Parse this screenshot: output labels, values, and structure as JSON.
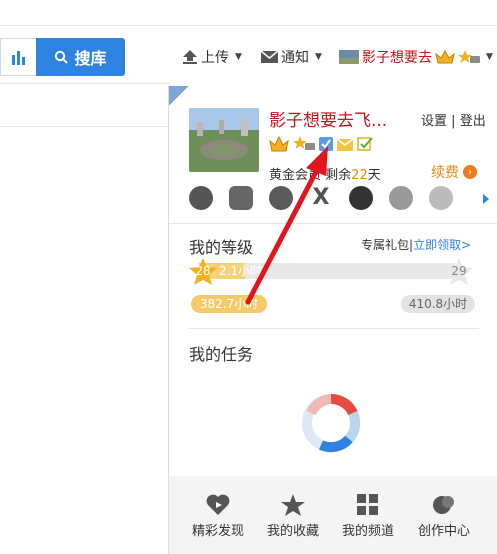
{
  "search": {
    "button_label": "搜库"
  },
  "nav": {
    "upload": "上传",
    "notify": "通知",
    "username": "影子想要去"
  },
  "panel": {
    "name": "影子想要去飞...",
    "settings": "设置",
    "logout": "登出",
    "separator": "|",
    "member_prefix": "黄金会员",
    "remaining_label": "剩余",
    "remaining_days": "22",
    "days_unit": "天",
    "renew": "续费",
    "level_title": "我的等级",
    "gift_label": "专属礼包",
    "gift_link": "立即领取>",
    "current_level": "28",
    "next_level": "29",
    "progress_text": "2.1小时",
    "progress_fraction": 0.18,
    "hours_done": "382.7小时",
    "hours_needed": "410.8小时",
    "task_title": "我的任务"
  },
  "bottom": [
    {
      "label": "精彩发现",
      "icon": "heart-icon"
    },
    {
      "label": "我的收藏",
      "icon": "star-icon"
    },
    {
      "label": "我的频道",
      "icon": "grid-icon"
    },
    {
      "label": "创作中心",
      "icon": "create-icon"
    }
  ],
  "colors": {
    "accent": "#2f83e0",
    "username": "#c0141a",
    "renew": "#e08a14",
    "arrow": "#e0161c"
  }
}
